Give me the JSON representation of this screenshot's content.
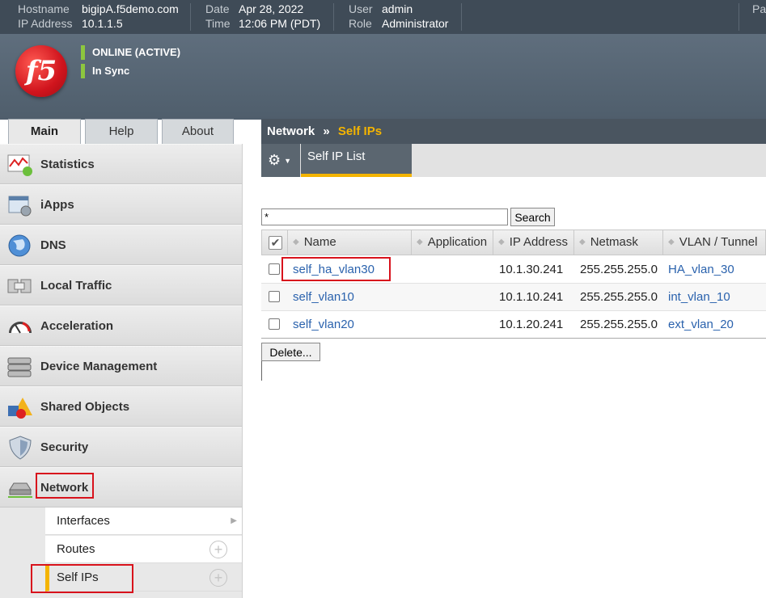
{
  "topbar": {
    "hostname_label": "Hostname",
    "hostname": "bigipA.f5demo.com",
    "ip_label": "IP Address",
    "ip": "10.1.1.5",
    "date_label": "Date",
    "date": "Apr 28, 2022",
    "time_label": "Time",
    "time": "12:06 PM (PDT)",
    "user_label": "User",
    "user": "admin",
    "role_label": "Role",
    "role": "Administrator",
    "partition_label": "Pa"
  },
  "header": {
    "logo_text": "f5",
    "status": "ONLINE (ACTIVE)",
    "sync": "In Sync",
    "status_color": "#8dc63f"
  },
  "tabs": [
    {
      "label": "Main",
      "active": true
    },
    {
      "label": "Help",
      "active": false
    },
    {
      "label": "About",
      "active": false
    }
  ],
  "sidebar": {
    "items": [
      {
        "label": "Statistics",
        "icon": "statistics-icon"
      },
      {
        "label": "iApps",
        "icon": "iapps-icon"
      },
      {
        "label": "DNS",
        "icon": "dns-globe-icon"
      },
      {
        "label": "Local Traffic",
        "icon": "local-traffic-icon"
      },
      {
        "label": "Acceleration",
        "icon": "gauge-icon"
      },
      {
        "label": "Device Management",
        "icon": "server-icon"
      },
      {
        "label": "Shared Objects",
        "icon": "shapes-icon"
      },
      {
        "label": "Security",
        "icon": "shield-icon"
      },
      {
        "label": "Network",
        "icon": "network-icon"
      }
    ],
    "network_sub": [
      {
        "label": "Interfaces"
      },
      {
        "label": "Routes"
      },
      {
        "label": "Self IPs"
      }
    ]
  },
  "main": {
    "breadcrumb_root": "Network",
    "breadcrumb_sep": "»",
    "breadcrumb_current": "Self IPs",
    "subtab": "Self IP List",
    "search_value": "*",
    "search_button": "Search",
    "delete_button": "Delete...",
    "columns": [
      "Name",
      "Application",
      "IP Address",
      "Netmask",
      "VLAN / Tunnel"
    ],
    "rows": [
      {
        "name": "self_ha_vlan30",
        "application": "",
        "ip": "10.1.30.241",
        "netmask": "255.255.255.0",
        "vlan": "HA_vlan_30"
      },
      {
        "name": "self_vlan10",
        "application": "",
        "ip": "10.1.10.241",
        "netmask": "255.255.255.0",
        "vlan": "int_vlan_10"
      },
      {
        "name": "self_vlan20",
        "application": "",
        "ip": "10.1.20.241",
        "netmask": "255.255.255.0",
        "vlan": "ext_vlan_20"
      }
    ]
  },
  "colors": {
    "accent": "#f4b400",
    "highlight": "#d8121c",
    "link": "#2a62ad"
  }
}
